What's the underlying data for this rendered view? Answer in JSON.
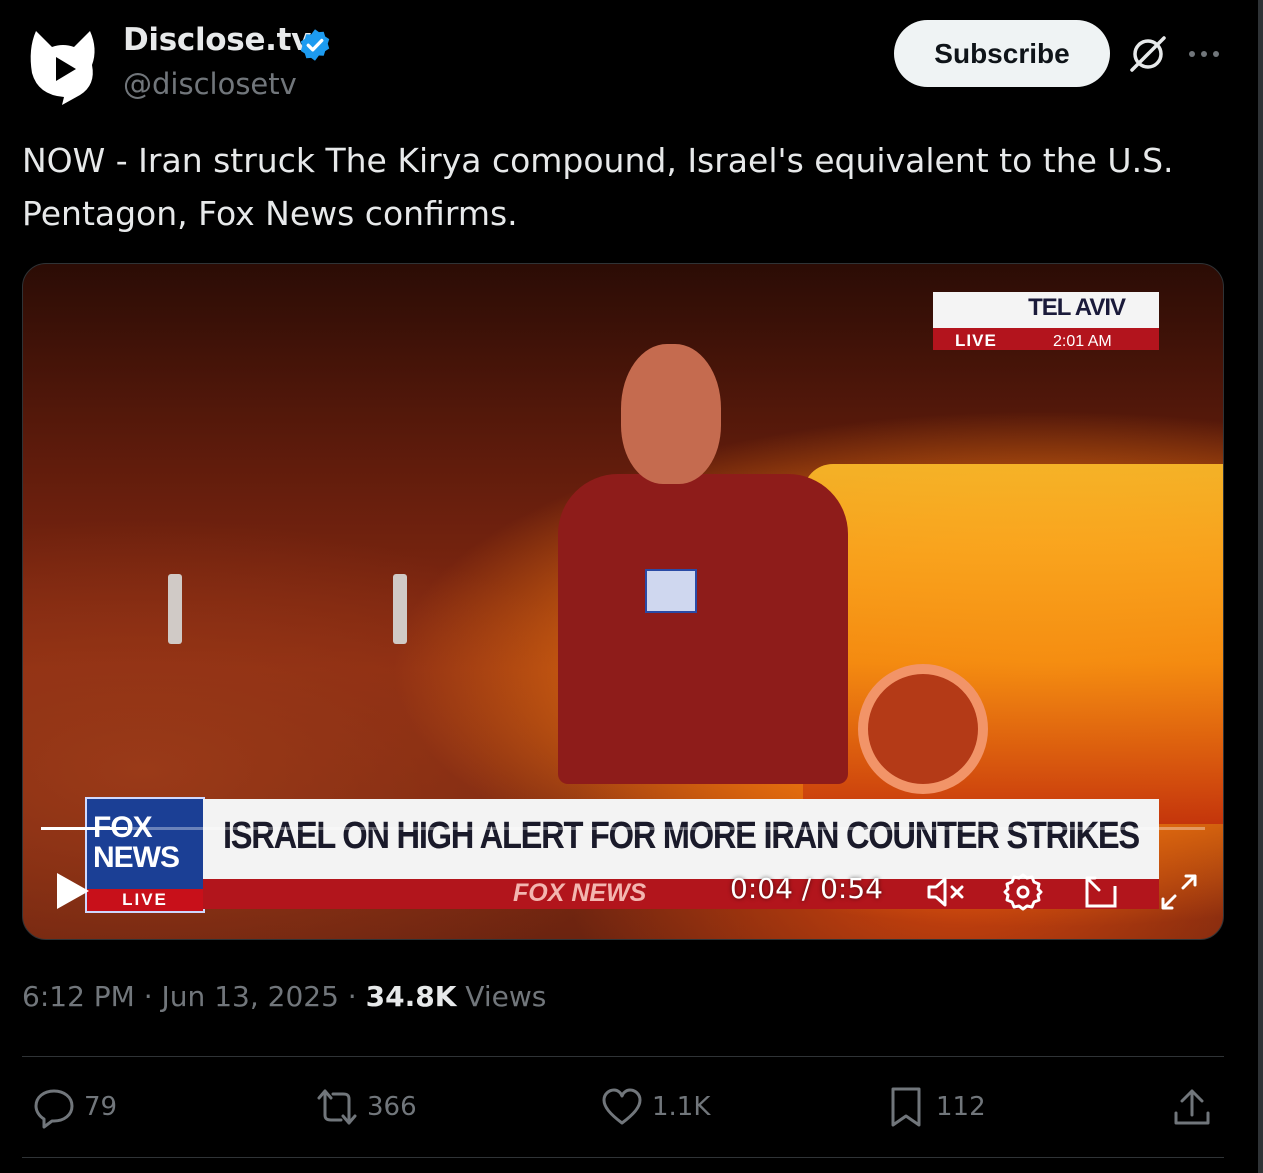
{
  "author": {
    "display_name": "Disclose.tv",
    "handle": "@disclosetv",
    "verified": true,
    "subscribe_label": "Subscribe"
  },
  "tweet": {
    "text": "NOW - Iran struck The Kirya compound, Israel's equivalent to the U.S. Pentagon, Fox News confirms."
  },
  "video": {
    "location_badge": {
      "city": "TEL AVIV",
      "live_label": "LIVE",
      "time": "2:01 AM"
    },
    "network_logo": {
      "line1": "FOX",
      "line2": "NEWS",
      "live_label": "LIVE"
    },
    "chyron_headline": "ISRAEL ON HIGH ALERT FOR MORE IRAN COUNTER STRIKES",
    "chyron_brand": "FOX NEWS",
    "current_time": "0:04",
    "duration": "0:54",
    "time_display": "0:04 / 0:54",
    "progress_fraction": 0.074,
    "muted": true
  },
  "meta": {
    "time": "6:12 PM",
    "date": "Jun 13, 2025",
    "separator": "·",
    "views_count": "34.8K",
    "views_label": "Views"
  },
  "actions": {
    "replies": "79",
    "reposts": "366",
    "likes": "1.1K",
    "bookmarks": "112"
  },
  "colors": {
    "background": "#000000",
    "text_primary": "#e7e9ea",
    "text_secondary": "#71767b",
    "verified_blue": "#1d9bf0",
    "divider": "#2f3336"
  },
  "icons": [
    "disclosetv-logo-icon",
    "verified-badge-icon",
    "grok-icon",
    "more-icon",
    "play-icon",
    "mute-icon",
    "settings-gear-icon",
    "pip-icon",
    "fullscreen-icon",
    "reply-icon",
    "repost-icon",
    "like-icon",
    "bookmark-icon",
    "share-icon"
  ]
}
